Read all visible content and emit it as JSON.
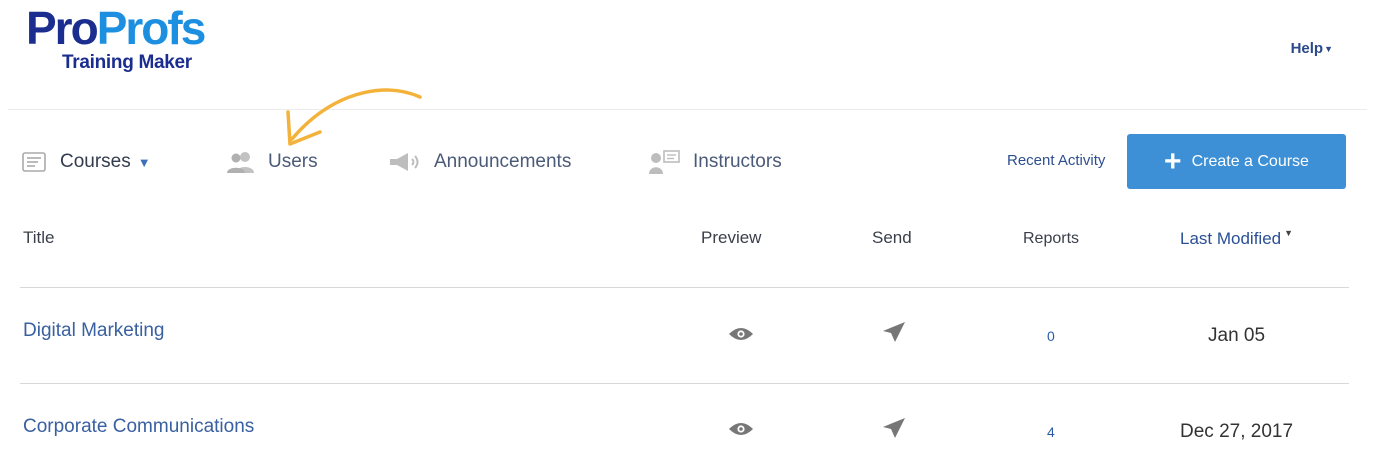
{
  "logo": {
    "part1": "Pro",
    "part2": "Profs",
    "subtitle": "Training Maker"
  },
  "header": {
    "help_label": "Help"
  },
  "nav": {
    "items": [
      {
        "label": "Courses",
        "icon": "courses-icon"
      },
      {
        "label": "Users",
        "icon": "users-icon"
      },
      {
        "label": "Announcements",
        "icon": "megaphone-icon"
      },
      {
        "label": "Instructors",
        "icon": "instructor-icon"
      }
    ],
    "recent_activity": "Recent Activity",
    "create_button": "Create a Course"
  },
  "table": {
    "headers": {
      "title": "Title",
      "preview": "Preview",
      "send": "Send",
      "reports": "Reports",
      "last_modified": "Last Modified"
    },
    "rows": [
      {
        "title": "Digital Marketing",
        "reports": "0",
        "last_modified": "Jan 05"
      },
      {
        "title": "Corporate Communications",
        "reports": "4",
        "last_modified": "Dec 27, 2017"
      }
    ]
  },
  "colors": {
    "brand_dark": "#1b2e8f",
    "brand_light": "#1d8fe0",
    "button": "#3d8fd6",
    "annotation_arrow": "#f3b23a"
  }
}
